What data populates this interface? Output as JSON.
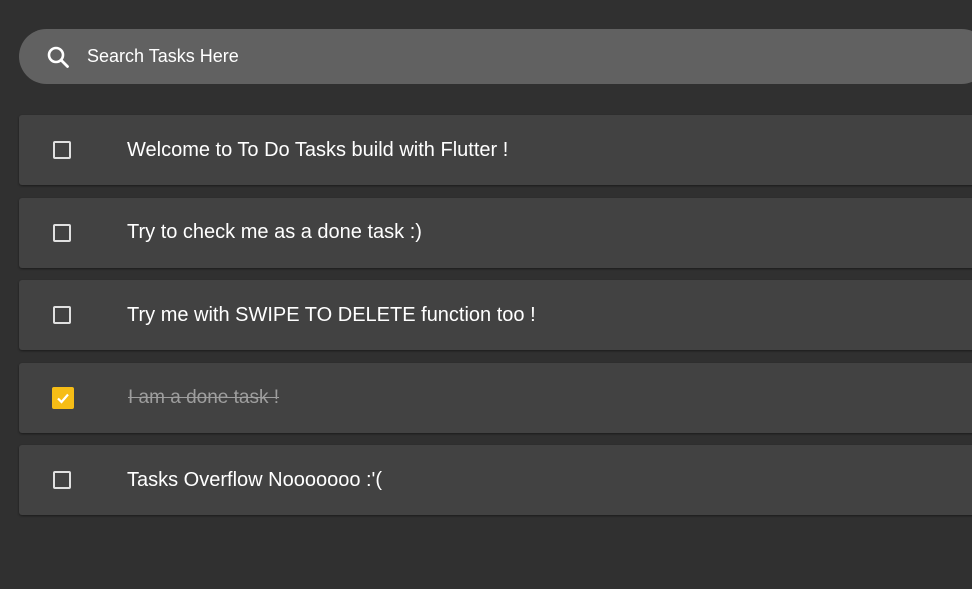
{
  "search": {
    "placeholder": "Search Tasks Here",
    "icon": "search-icon"
  },
  "tasks": [
    {
      "label": "Welcome to To Do Tasks build with Flutter !",
      "done": false
    },
    {
      "label": "Try to check me as a done task :)",
      "done": false
    },
    {
      "label": "Try me with SWIPE TO DELETE function too !",
      "done": false
    },
    {
      "label": "I am a done task !",
      "done": true
    },
    {
      "label": "Tasks Overflow Nooooooo :'(",
      "done": false
    }
  ],
  "colors": {
    "background": "#303030",
    "search_bar": "#616161",
    "card": "#424242",
    "accent": "#f6bd16",
    "done_text": "#9e9e9e"
  }
}
